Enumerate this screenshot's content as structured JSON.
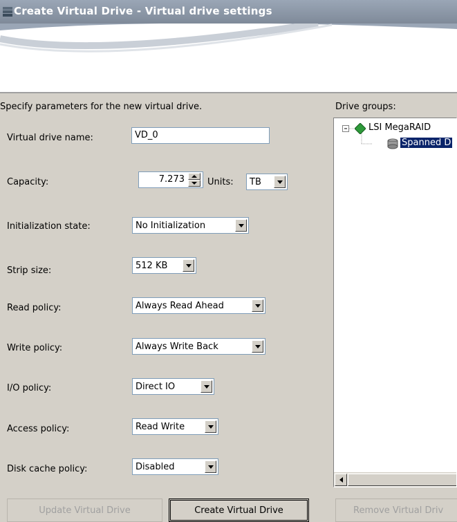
{
  "window": {
    "title": "Create Virtual Drive - Virtual drive settings"
  },
  "instructions": "Specify parameters for the new virtual drive.",
  "form": {
    "vd_name": {
      "label": "Virtual drive name:",
      "value": "VD_0"
    },
    "capacity": {
      "label": "Capacity:",
      "value": "7.273",
      "units_label": "Units:",
      "units_value": "TB"
    },
    "init_state": {
      "label": "Initialization state:",
      "value": "No Initialization"
    },
    "strip_size": {
      "label": "Strip size:",
      "value": "512 KB"
    },
    "read_policy": {
      "label": "Read policy:",
      "value": "Always Read Ahead"
    },
    "write_policy": {
      "label": "Write policy:",
      "value": "Always Write Back"
    },
    "io_policy": {
      "label": "I/O policy:",
      "value": "Direct IO"
    },
    "access_policy": {
      "label": "Access policy:",
      "value": "Read Write"
    },
    "disk_cache_policy": {
      "label": "Disk cache policy:",
      "value": "Disabled"
    }
  },
  "drive_groups": {
    "label": "Drive groups:",
    "root": "LSI MegaRAID",
    "child": "Spanned D"
  },
  "buttons": {
    "update": "Update Virtual Drive",
    "create": "Create Virtual Drive",
    "remove": "Remove Virtual Driv"
  },
  "colors": {
    "selection": "#0a246a",
    "titlebar": "#8a95a5"
  }
}
